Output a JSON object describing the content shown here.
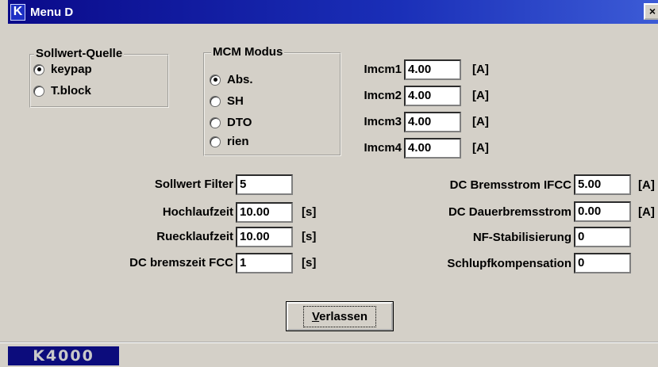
{
  "window": {
    "title": "Menu D",
    "app_icon": "K",
    "close": "×"
  },
  "sollwert_quelle": {
    "title": "Sollwert-Quelle",
    "options": [
      {
        "label": "keypap",
        "selected": true
      },
      {
        "label": "T.block",
        "selected": false
      }
    ]
  },
  "mcm_modus": {
    "title": "MCM Modus",
    "options": [
      {
        "label": "Abs.",
        "selected": true
      },
      {
        "label": "SH",
        "selected": false
      },
      {
        "label": "DTO",
        "selected": false
      },
      {
        "label": "rien",
        "selected": false
      }
    ]
  },
  "imcm": [
    {
      "label": "Imcm1",
      "value": "4.00",
      "unit": "[A]"
    },
    {
      "label": "Imcm2",
      "value": "4.00",
      "unit": "[A]"
    },
    {
      "label": "Imcm3",
      "value": "4.00",
      "unit": "[A]"
    },
    {
      "label": "Imcm4",
      "value": "4.00",
      "unit": "[A]"
    }
  ],
  "left_params": [
    {
      "label": "Sollwert Filter",
      "value": "5",
      "unit": ""
    },
    {
      "label": "Hochlaufzeit",
      "value": "10.00",
      "unit": "[s]"
    },
    {
      "label": "Ruecklaufzeit",
      "value": "10.00",
      "unit": "[s]"
    },
    {
      "label": "DC bremszeit FCC",
      "value": "1",
      "unit": "[s]"
    }
  ],
  "right_params": [
    {
      "label": "DC Bremsstrom IFCC",
      "value": "5.00",
      "unit": "[A]"
    },
    {
      "label": "DC Dauerbremsstrom",
      "value": "0.00",
      "unit": "[A]"
    },
    {
      "label": "NF-Stabilisierung",
      "value": "0",
      "unit": ""
    },
    {
      "label": "Schlupfkompensation",
      "value": "0",
      "unit": ""
    }
  ],
  "button": {
    "accel": "V",
    "rest": "erlassen"
  },
  "statusbar": {
    "label": "K4000"
  },
  "colors": {
    "titlebar": "#0a0a8a",
    "face": "#d4d0c8",
    "status_bg": "#0c0c7c"
  }
}
